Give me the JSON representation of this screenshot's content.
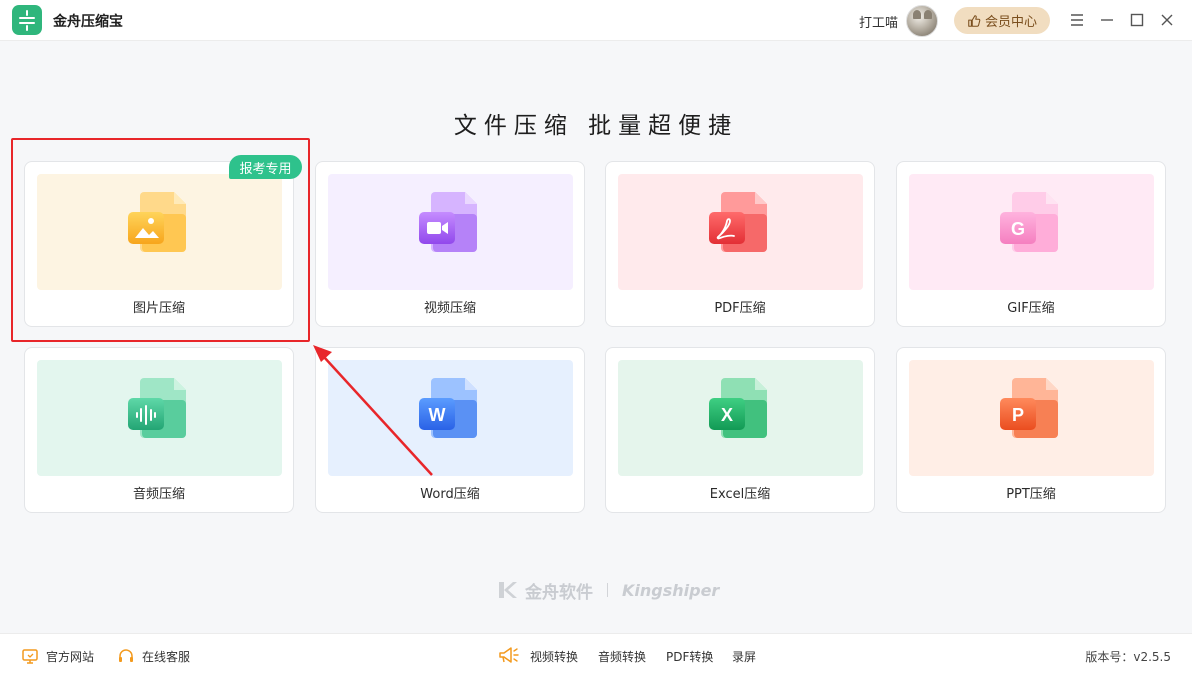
{
  "app": {
    "title": "金舟压缩宝"
  },
  "header": {
    "user_name": "打工喵",
    "member_label": "会员中心"
  },
  "headline": "文件压缩  批量超便捷",
  "cards": [
    {
      "label": "图片压缩",
      "icon": "image-file-icon",
      "badge": "报考专用"
    },
    {
      "label": "视频压缩",
      "icon": "video-file-icon"
    },
    {
      "label": "PDF压缩",
      "icon": "pdf-file-icon"
    },
    {
      "label": "GIF压缩",
      "icon": "gif-file-icon",
      "glyph": "G"
    },
    {
      "label": "音频压缩",
      "icon": "audio-file-icon"
    },
    {
      "label": "Word压缩",
      "icon": "word-file-icon",
      "glyph": "W"
    },
    {
      "label": "Excel压缩",
      "icon": "excel-file-icon",
      "glyph": "X"
    },
    {
      "label": "PPT压缩",
      "icon": "ppt-file-icon",
      "glyph": "P"
    }
  ],
  "watermark": {
    "cn": "金舟软件",
    "en": "Kingshiper"
  },
  "footer": {
    "site": "官方网站",
    "service": "在线客服",
    "links": [
      "视频转换",
      "音频转换",
      "PDF转换",
      "录屏"
    ],
    "version": "版本号：v2.5.5"
  },
  "colors": {
    "accent": "#2fb67c",
    "highlight": "#e8262a",
    "badge": "#2ec28c"
  }
}
